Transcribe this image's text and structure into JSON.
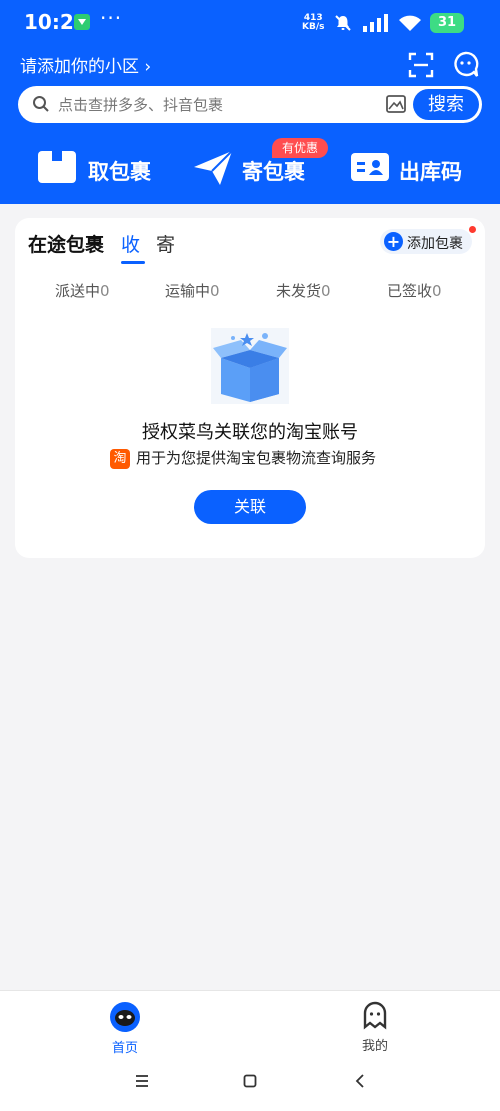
{
  "status_bar": {
    "time": "10:21",
    "more": "···",
    "net_speed_value": "413",
    "net_speed_unit": "KB/s",
    "battery": "31"
  },
  "header": {
    "location": "请添加你的小区 ›"
  },
  "search": {
    "placeholder": "点击查拼多多、抖音包裹",
    "button": "搜索"
  },
  "quick_actions": {
    "pickup": "取包裹",
    "send": "寄包裹",
    "send_badge": "有优惠",
    "outbound_code": "出库码"
  },
  "card": {
    "title": "在途包裹",
    "tab_receive": "收",
    "tab_send": "寄",
    "add_package": "添加包裹",
    "stats": [
      {
        "label": "派送中",
        "count": "0"
      },
      {
        "label": "运输中",
        "count": "0"
      },
      {
        "label": "未发货",
        "count": "0"
      },
      {
        "label": "已签收",
        "count": "0"
      }
    ],
    "auth_title": "授权菜鸟关联您的淘宝账号",
    "taobao_badge": "淘",
    "auth_subtitle": "用于为您提供淘宝包裹物流查询服务",
    "link_button": "关联"
  },
  "bottom_nav": {
    "home": "首页",
    "mine": "我的"
  },
  "colors": {
    "brand_blue": "#0a61ff",
    "promo_red": "#ff4d4f",
    "taobao_orange": "#ff5a00"
  }
}
